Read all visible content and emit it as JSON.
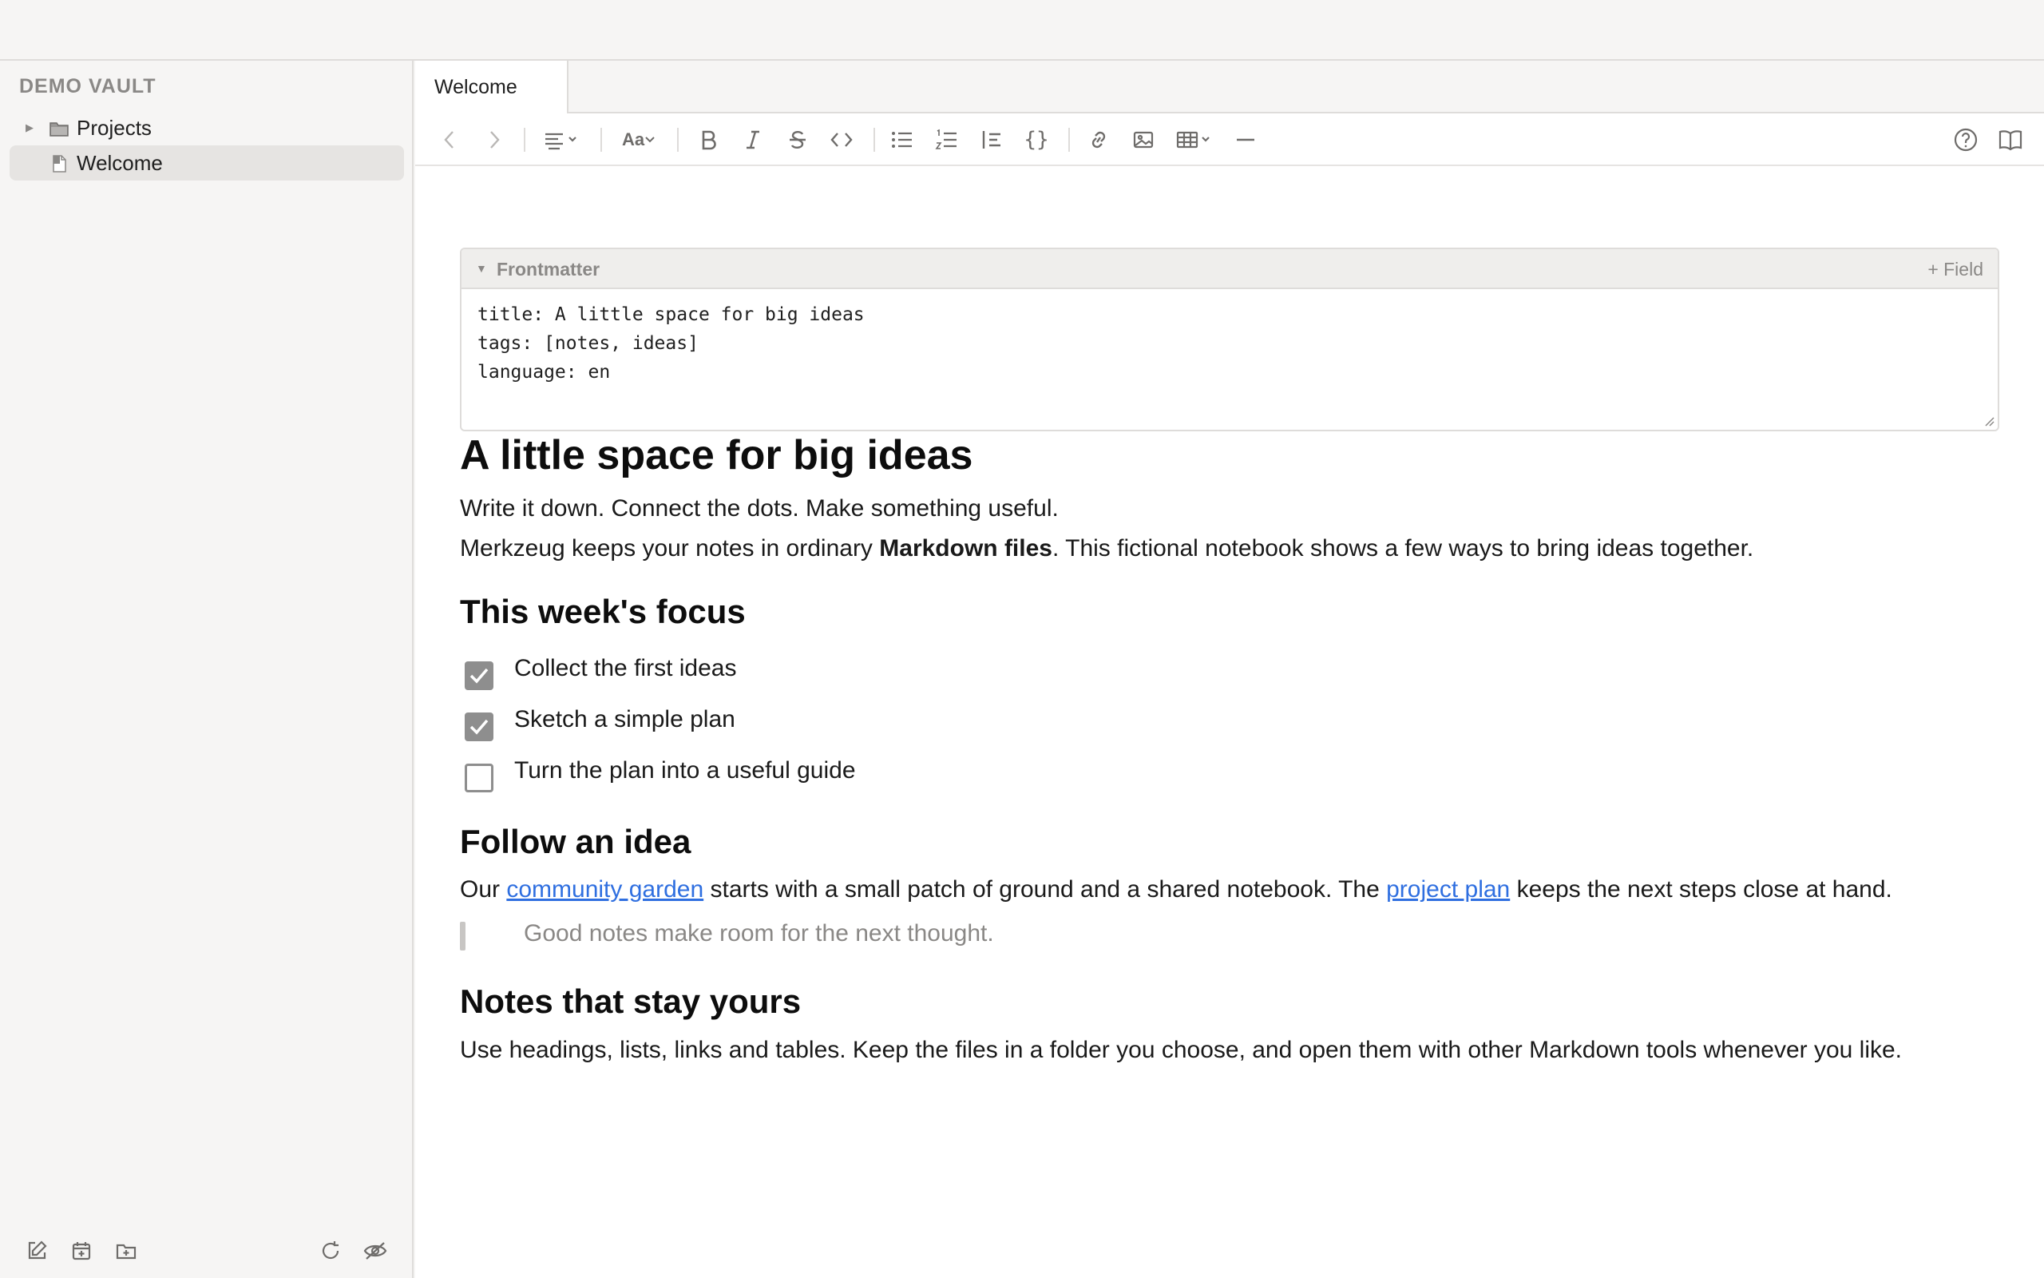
{
  "sidebar": {
    "vault_name": "DEMO VAULT",
    "items": [
      {
        "label": "Projects",
        "type": "folder",
        "expanded": false,
        "selected": false
      },
      {
        "label": "Welcome",
        "type": "file",
        "selected": true
      }
    ]
  },
  "tabs": [
    {
      "label": "Welcome",
      "active": true
    }
  ],
  "toolbar": {
    "buttons": [
      "back",
      "forward",
      "align",
      "font-size",
      "bold",
      "italic",
      "strikethrough",
      "inline-code",
      "bullet-list",
      "numbered-list",
      "blockquote",
      "code-block",
      "link",
      "image",
      "table",
      "horizontal-rule",
      "help",
      "reading-mode"
    ],
    "font_size_label": "Aa",
    "code_block_label": "{}"
  },
  "frontmatter": {
    "title": "Frontmatter",
    "add_field": "+ Field",
    "lines": [
      "title: A little space for big ideas",
      "tags: [notes, ideas]",
      "language: en"
    ]
  },
  "document": {
    "h1": "A little space for big ideas",
    "intro_line": "Write it down. Connect the dots. Make something useful.",
    "intro_p_before": "Merkzeug keeps your notes in ordinary ",
    "intro_p_bold": "Markdown files",
    "intro_p_after": ". This fictional notebook shows a few ways to bring ideas together.",
    "focus_heading": "This week's focus",
    "tasks": [
      {
        "label": "Collect the first ideas",
        "done": true
      },
      {
        "label": "Sketch a simple plan",
        "done": true
      },
      {
        "label": "Turn the plan into a useful guide",
        "done": false
      }
    ],
    "follow_heading": "Follow an idea",
    "follow_p1": "Our ",
    "follow_link1": "community garden",
    "follow_p2": " starts with a small patch of ground and a shared notebook. The ",
    "follow_link2": "project plan",
    "follow_p3": " keeps the next steps close at hand.",
    "quote": "Good notes make room for the next thought.",
    "yours_heading": "Notes that stay yours",
    "yours_p": "Use headings, lists, links and tables. Keep the files in a folder you choose, and open them with other Markdown tools whenever you like."
  },
  "sidebar_footer": {
    "buttons": [
      "new-note",
      "daily-note",
      "new-folder",
      "refresh",
      "toggle-hidden"
    ]
  },
  "colors": {
    "link": "#2f6fe0",
    "checkbox": "#8e8e8e",
    "sidebar_bg": "#f6f5f4",
    "selected_bg": "#e6e4e2"
  }
}
